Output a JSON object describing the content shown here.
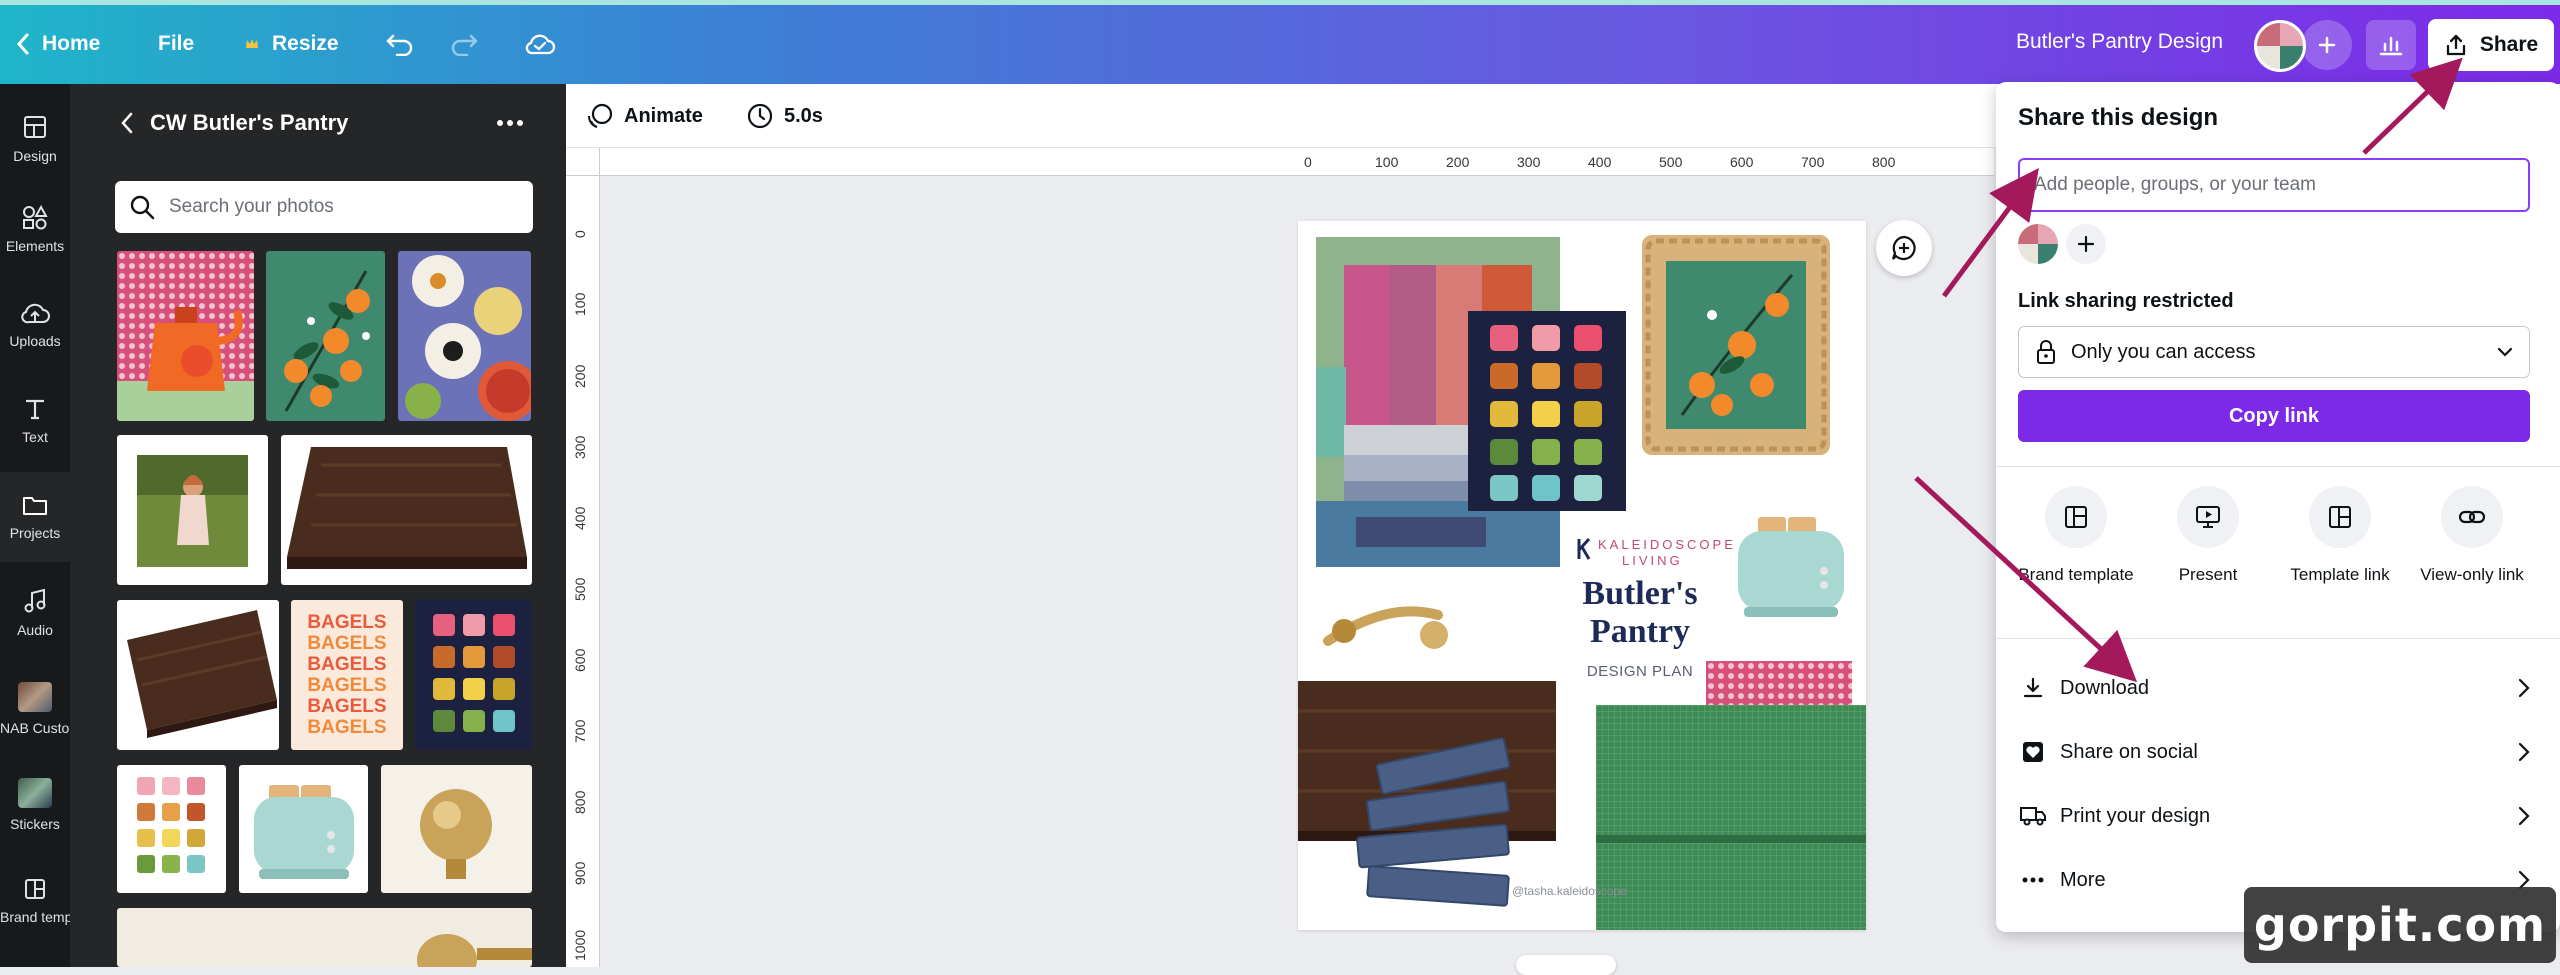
{
  "header": {
    "home_label": "Home",
    "file_label": "File",
    "resize_label": "Resize",
    "doc_title": "Butler's Pantry Design",
    "share_label": "Share"
  },
  "rail": {
    "items": [
      {
        "label": "Design",
        "icon": "design-icon"
      },
      {
        "label": "Elements",
        "icon": "elements-icon"
      },
      {
        "label": "Uploads",
        "icon": "uploads-icon"
      },
      {
        "label": "Text",
        "icon": "text-icon"
      },
      {
        "label": "Projects",
        "icon": "projects-icon"
      },
      {
        "label": "Audio",
        "icon": "audio-icon"
      },
      {
        "label": "NAB Custo...",
        "icon": "app-thumbnail"
      },
      {
        "label": "Stickers",
        "icon": "app-thumbnail"
      },
      {
        "label": "Brand temp...",
        "icon": "brand-template-icon"
      }
    ]
  },
  "panel": {
    "title": "CW Butler's Pantry",
    "search_placeholder": "Search your photos",
    "bagels_word": "BAGELS"
  },
  "toolbar": {
    "animate_label": "Animate",
    "duration_label": "5.0s"
  },
  "rulers": {
    "h_ticks": [
      "0",
      "100",
      "200",
      "300",
      "400",
      "500",
      "600",
      "700",
      "800"
    ],
    "v_ticks": [
      "0",
      "100",
      "200",
      "300",
      "400",
      "500",
      "600",
      "700",
      "800",
      "900",
      "1000"
    ]
  },
  "canvas": {
    "brand_line1": "KALEIDOSCOPE",
    "brand_line2": "LIVING",
    "title_line1": "Butler's",
    "title_line2": "Pantry",
    "subtitle": "DESIGN PLAN",
    "handle": "@tasha.kaleidoscope"
  },
  "share_panel": {
    "title": "Share this design",
    "input_placeholder": "Add people, groups, or your team",
    "link_label": "Link sharing restricted",
    "access_value": "Only you can access",
    "copy_label": "Copy link",
    "options": [
      {
        "label": "Brand template",
        "icon": "brand-template-icon"
      },
      {
        "label": "Present",
        "icon": "present-icon"
      },
      {
        "label": "Template link",
        "icon": "template-link-icon"
      },
      {
        "label": "View-only link",
        "icon": "link-icon"
      }
    ],
    "rows": [
      {
        "label": "Download",
        "icon": "download-icon"
      },
      {
        "label": "Share on social",
        "icon": "heart-icon"
      },
      {
        "label": "Print your design",
        "icon": "truck-icon"
      },
      {
        "label": "More",
        "icon": "more-icon"
      }
    ]
  },
  "watermark": "gorpit.com",
  "colors": {
    "accent": "#7d2ae8",
    "annotation_arrow": "#a3195b"
  }
}
